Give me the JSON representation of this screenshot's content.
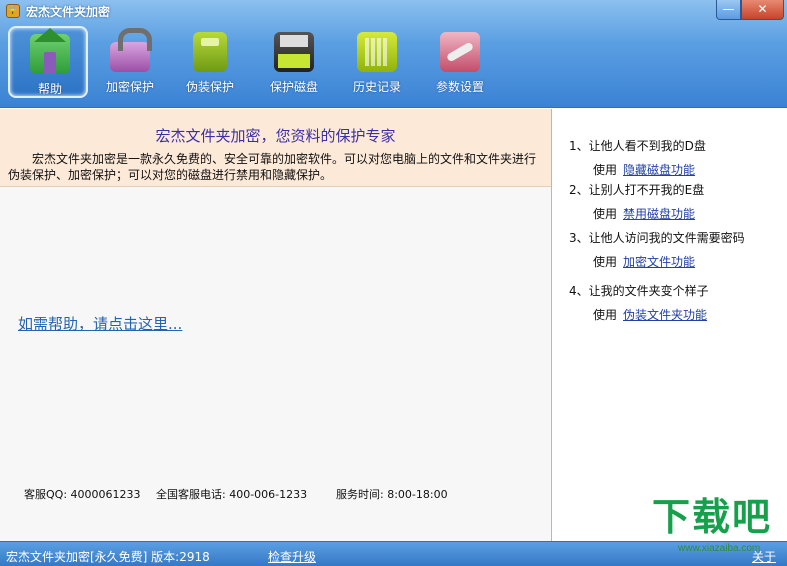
{
  "window": {
    "title": "宏杰文件夹加密",
    "minimize_symbol": "—",
    "close_symbol": "✕"
  },
  "toolbar": {
    "items": [
      {
        "label": "帮助",
        "icon": "home-icon",
        "active": true
      },
      {
        "label": "加密保护",
        "icon": "lock-icon",
        "active": false
      },
      {
        "label": "伪装保护",
        "icon": "book-icon",
        "active": false
      },
      {
        "label": "保护磁盘",
        "icon": "disk-icon",
        "active": false
      },
      {
        "label": "历史记录",
        "icon": "history-icon",
        "active": false
      },
      {
        "label": "参数设置",
        "icon": "tools-icon",
        "active": false
      }
    ]
  },
  "intro": {
    "title": "宏杰文件夹加密，您资料的保护专家",
    "text": "宏杰文件夹加密是一款永久免费的、安全可靠的加密软件。可以对您电脑上的文件和文件夹进行伪装保护、加密保护；可以对您的磁盘进行禁用和隐藏保护。"
  },
  "help_link": "如需帮助，请点击这里...",
  "contact": {
    "qq": "客服QQ: 4000061233",
    "phone": "全国客服电话: 400-006-1233",
    "hours": "服务时间: 8:00-18:00"
  },
  "tips": [
    {
      "question": "1、让他人看不到我的D盘",
      "use": "使用",
      "link": "隐藏磁盘功能"
    },
    {
      "question": "2、让别人打不开我的E盘",
      "use": "使用",
      "link": "禁用磁盘功能"
    },
    {
      "question": "3、让他人访问我的文件需要密码",
      "use": "使用",
      "link": "加密文件功能"
    },
    {
      "question": "4、让我的文件夹变个样子",
      "use": "使用",
      "link": "伪装文件夹功能"
    }
  ],
  "status": {
    "app_version": "宏杰文件夹加密[永久免费]  版本:2918",
    "upgrade": "检查升级",
    "about": "关于"
  },
  "watermark": {
    "main": "下载吧",
    "sub": "www.xiazaiba.com"
  },
  "colors": {
    "titlebar": "#5b9fe2",
    "intro_bg": "#fde9d8",
    "intro_title": "#3a2fa6",
    "link": "#2240a6",
    "watermark": "#17a04c"
  }
}
